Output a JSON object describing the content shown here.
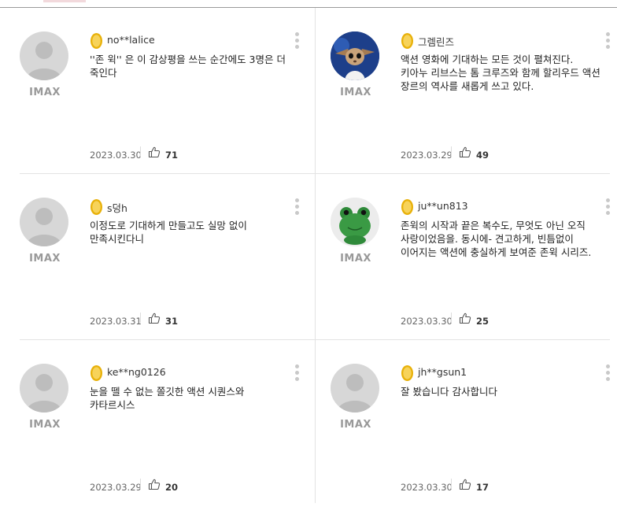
{
  "colors": {
    "medal": "#e8b10a",
    "medal_light": "#f7d35a",
    "avatar_bg": "#d7d7d7",
    "badge_gray": "#999999"
  },
  "reviews": [
    {
      "user": "no**lalice",
      "avatar": "default-avatar-icon",
      "badge": "IMAX",
      "text": "''존 윅'' 은 이 감상평을 쓰는 순간에도 3명은 더 죽인다",
      "date": "2023.03.30",
      "likes": "71"
    },
    {
      "user": "그렘린즈",
      "avatar": "gremlin-avatar",
      "badge": "IMAX",
      "text": "액션 영화에 기대하는 모든 것이 펼쳐진다. 키아누 리브스는 톰 크루즈와 함께 할리우드 액션 장르의 역사를 새롭게 쓰고 있다.",
      "date": "2023.03.29",
      "likes": "49"
    },
    {
      "user": "s덩h",
      "avatar": "default-avatar-icon",
      "badge": "IMAX",
      "text": "이정도로 기대하게 만들고도 실망 없이 만족시킨다니",
      "date": "2023.03.31",
      "likes": "31"
    },
    {
      "user": "ju**un813",
      "avatar": "frog-avatar",
      "badge": "IMAX",
      "text": "존윅의 시작과 끝은 복수도, 무엇도 아닌 오직 사랑이었음을. 동시에- 견고하게, 빈틈없이 이어지는 액션에 충실하게 보여준 존윅 시리즈.",
      "date": "2023.03.30",
      "likes": "25"
    },
    {
      "user": "ke**ng0126",
      "avatar": "default-avatar-icon",
      "badge": "IMAX",
      "text": "눈을 뗄 수 없는 쫄깃한 액션 시퀀스와 카타르시스",
      "date": "2023.03.29",
      "likes": "20"
    },
    {
      "user": "jh**gsun1",
      "avatar": "default-avatar-icon",
      "badge": "IMAX",
      "text": "잘 봤습니다 감사합니다",
      "date": "2023.03.30",
      "likes": "17"
    }
  ]
}
